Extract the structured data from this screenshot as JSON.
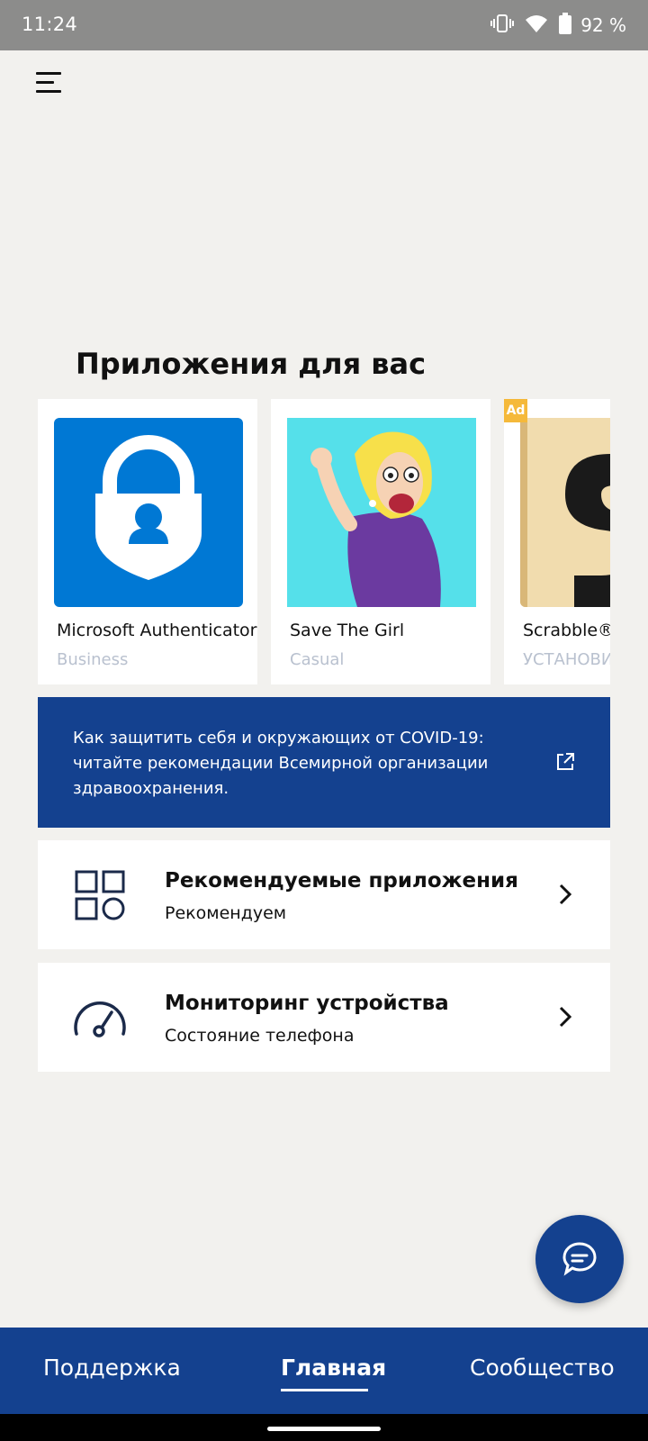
{
  "status_bar": {
    "time": "11:24",
    "battery": "92 %",
    "icons": [
      "vibrate-icon",
      "wifi-icon",
      "battery-icon"
    ]
  },
  "header": {
    "menu_icon": "hamburger-menu-icon"
  },
  "apps_section": {
    "title": "Приложения для вас",
    "apps": [
      {
        "name": "Microsoft Authenticator",
        "category": "Business",
        "icon": "authenticator-icon"
      },
      {
        "name": "Save The Girl",
        "category": "Casual",
        "icon": "save-the-girl-icon"
      },
      {
        "name": "Scrabble®",
        "category": "УСТАНОВИТЬ",
        "icon": "scrabble-icon",
        "ad_label": "Ad"
      }
    ]
  },
  "covid_banner": {
    "text": "Как защитить себя и окружающих от COVID-19: читайте рекомендации Всемирной организации здравоохранения.",
    "icon": "external-link-icon"
  },
  "list": [
    {
      "title": "Рекомендуемые приложения",
      "subtitle": "Рекомендуем",
      "icon": "apps-grid-icon"
    },
    {
      "title": "Мониторинг устройства",
      "subtitle": "Состояние телефона",
      "icon": "speedometer-icon"
    }
  ],
  "fab": {
    "icon": "chat-bubble-icon"
  },
  "bottom_nav": {
    "items": [
      {
        "label": "Поддержка",
        "active": false
      },
      {
        "label": "Главная",
        "active": true
      },
      {
        "label": "Сообщество",
        "active": false
      }
    ]
  },
  "colors": {
    "brand_blue": "#14418f",
    "authenticator_blue": "#0078d4",
    "ad_badge": "#f5b93a",
    "background": "#f2f1ee",
    "category_text": "#b9c1cf"
  }
}
